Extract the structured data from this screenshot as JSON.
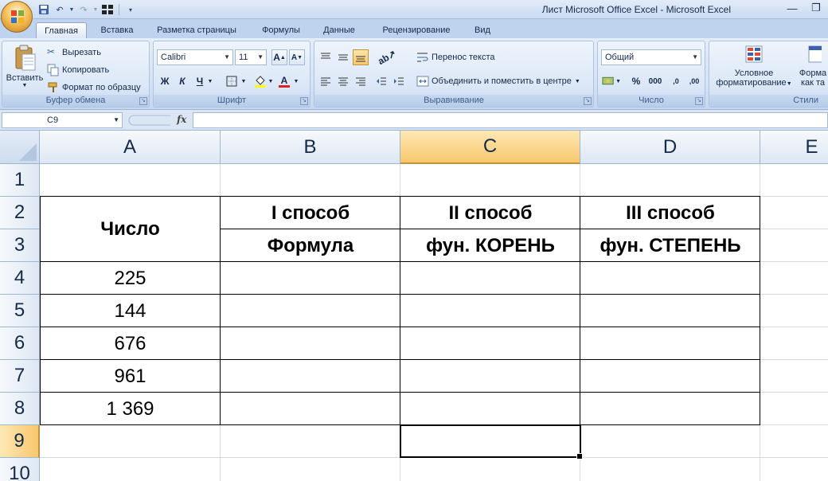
{
  "window": {
    "title": "Лист Microsoft Office Excel - Microsoft Excel"
  },
  "tabs": [
    "Главная",
    "Вставка",
    "Разметка страницы",
    "Формулы",
    "Данные",
    "Рецензирование",
    "Вид"
  ],
  "ribbon": {
    "clipboard": {
      "label": "Буфер обмена",
      "paste": "Вставить",
      "cut": "Вырезать",
      "copy": "Копировать",
      "format_painter": "Формат по образцу"
    },
    "font": {
      "label": "Шрифт",
      "name": "Calibri",
      "size": "11",
      "bold": "Ж",
      "italic": "К",
      "underline": "Ч",
      "grow": "A",
      "shrink": "A",
      "color_letter": "A"
    },
    "alignment": {
      "label": "Выравнивание",
      "wrap": "Перенос текста",
      "merge": "Объединить и поместить в центре"
    },
    "number": {
      "label": "Число",
      "format": "Общий",
      "percent": "%",
      "thousands": "000",
      "inc": ",0",
      "dec": ",00"
    },
    "styles": {
      "label": "Стили",
      "conditional_line1": "Условное",
      "conditional_line2": "форматирование",
      "table_line1": "Форма",
      "table_line2": "как та"
    }
  },
  "formula_bar": {
    "name_box": "C9",
    "fx": "fx",
    "value": ""
  },
  "columns": [
    "A",
    "B",
    "C",
    "D",
    "E"
  ],
  "rows": [
    "1",
    "2",
    "3",
    "4",
    "5",
    "6",
    "7",
    "8",
    "9",
    "10"
  ],
  "sheet": {
    "a23": "Число",
    "b2": "I способ",
    "c2": "II способ",
    "d2": "III способ",
    "b3": "Формула",
    "c3": "фун. КОРЕНЬ",
    "d3": "фун. СТЕПЕНЬ",
    "numbers": [
      "225",
      "144",
      "676",
      "961",
      "1 369"
    ]
  },
  "colors": {
    "selection_header": "#f8c76d",
    "ribbon": "#d5e3f5"
  }
}
